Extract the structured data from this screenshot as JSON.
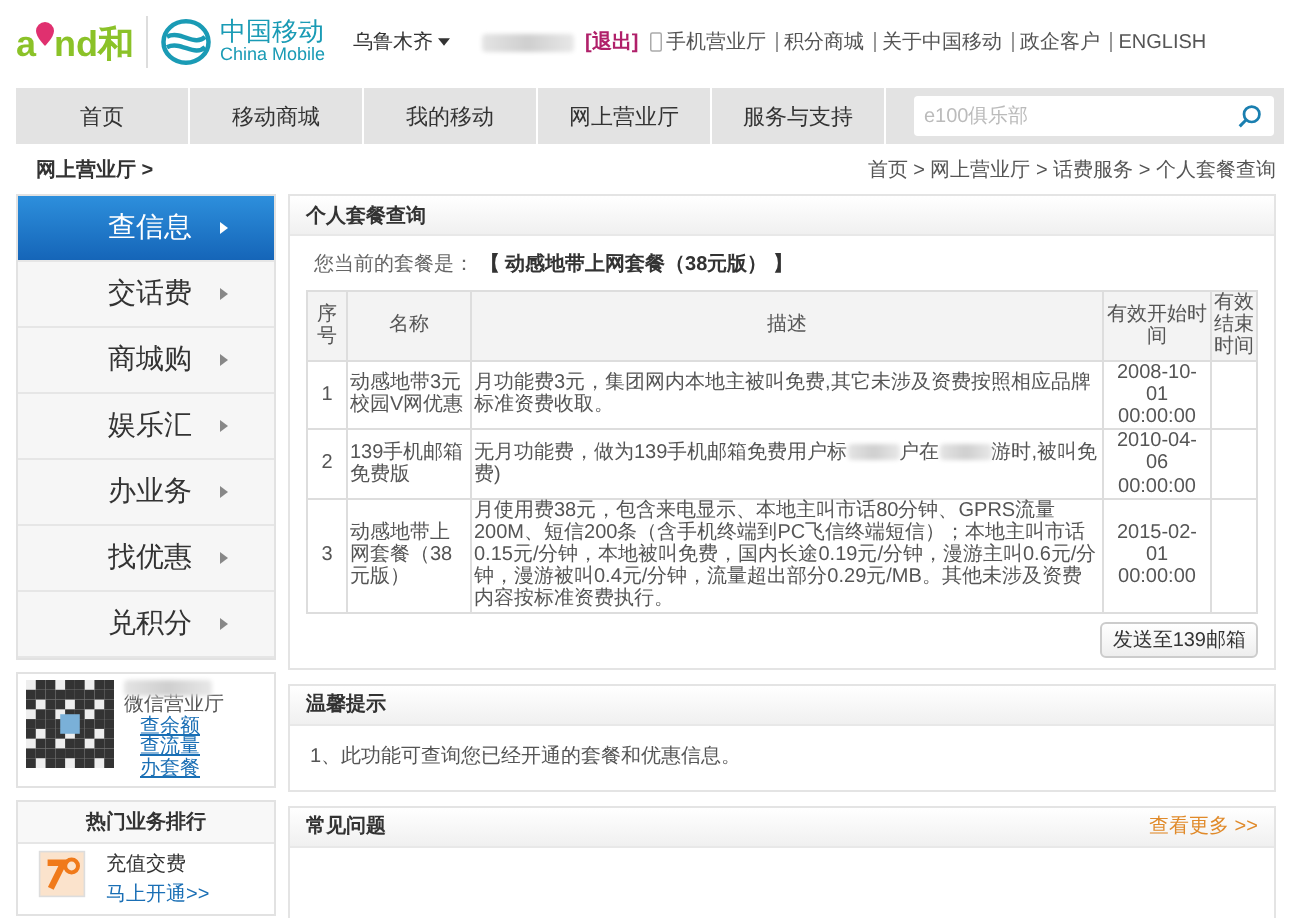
{
  "header": {
    "brand_left": "a",
    "brand_right": "nd和",
    "logo_cn": "中国移动",
    "logo_en": "China Mobile",
    "city": "乌鲁木齐",
    "logout": "[退出]",
    "links": [
      {
        "label": "手机营业厅",
        "kind": "phone"
      },
      {
        "label": "积分商城",
        "kind": "plain"
      },
      {
        "label": "关于中国移动",
        "kind": "plain"
      },
      {
        "label": "政企客户",
        "kind": "plain"
      },
      {
        "label": "ENGLISH",
        "kind": "plain"
      }
    ]
  },
  "nav": {
    "items": [
      {
        "label": "首页"
      },
      {
        "label": "移动商城"
      },
      {
        "label": "我的移动"
      },
      {
        "label": "网上营业厅"
      },
      {
        "label": "服务与支持"
      }
    ],
    "search": {
      "placeholder": "e100俱乐部"
    }
  },
  "breadcrumb": {
    "section": "网上营业厅 >",
    "path": "首页 > 网上营业厅 > 话费服务 > 个人套餐查询"
  },
  "sidebar": {
    "items": [
      {
        "label": "查信息",
        "selected": true
      },
      {
        "label": "交话费",
        "selected": false
      },
      {
        "label": "商城购",
        "selected": false
      },
      {
        "label": "娱乐汇",
        "selected": false
      },
      {
        "label": "办业务",
        "selected": false
      },
      {
        "label": "找优惠",
        "selected": false
      },
      {
        "label": "兑积分",
        "selected": false
      }
    ],
    "wechat": {
      "label": "微信营业厅",
      "links": [
        "查余额",
        "查流量",
        "办套餐"
      ]
    },
    "hot": {
      "title": "热门业务排行",
      "item": "充值交费",
      "link": "马上开通>>"
    }
  },
  "plan_panel": {
    "title": "个人套餐查询",
    "current_label": "您当前的套餐是：",
    "current_value": "【 动感地带上网套餐（38元版） 】",
    "table": {
      "columns": [
        "序号",
        "名称",
        "描述",
        "有效开始时间",
        "有效结束时间"
      ],
      "rows": [
        {
          "cells": [
            "1",
            "动感地带3元校园V网优惠",
            [
              "月功能费3元，集团网内本地主被叫免费,其它未涉及资费按照相应品牌标准资费收取。"
            ],
            "2008-10-01 00:00:00",
            ""
          ]
        },
        {
          "cells": [
            "2",
            "139手机邮箱免费版",
            [
              "无月功能费，做为139手机邮箱免费用户标",
              "户在",
              "游时,被叫免费)"
            ],
            "2010-04-06 00:00:00",
            ""
          ]
        },
        {
          "cells": [
            "3",
            "动感地带上网套餐（38元版）",
            [
              "月使用费38元，包含来电显示、本地主叫市话80分钟、GPRS流量200M、短信200条（含手机终端到PC飞信终端短信）；本地主叫市话0.15元/分钟，本地被叫免费，国内长途0.19元/分钟，漫游主叫0.6元/分钟，漫游被叫0.4元/分钟，流量超出部分0.29元/MB。其他未涉及资费内容按标准资费执行。"
            ],
            "2015-02-01 00:00:00",
            ""
          ]
        }
      ]
    },
    "send_button": "发送至139邮箱"
  },
  "tips_panel": {
    "title": "温馨提示",
    "text": "1、此功能可查询您已经开通的套餐和优惠信息。"
  },
  "faq_panel": {
    "title": "常见问题",
    "more": "查看更多 >>"
  }
}
